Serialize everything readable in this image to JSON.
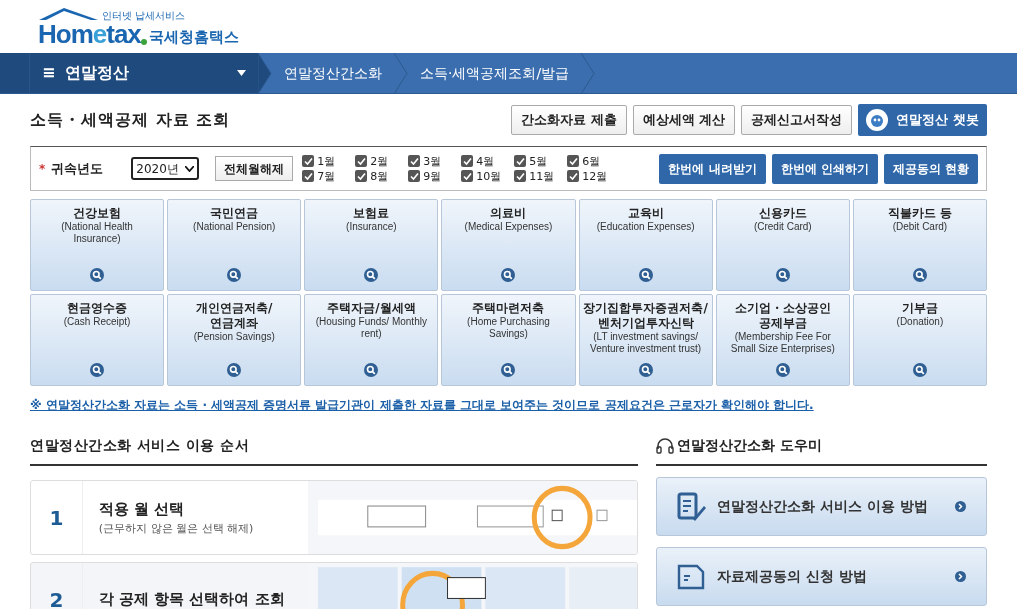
{
  "logo": {
    "tagline": "인터넷 납세서비스",
    "wordmark_left": "Hom",
    "wordmark_e": "e",
    "wordmark_right": "tax",
    "korean": "국세청홈택스"
  },
  "nav": {
    "menu_icon": "≡",
    "menu": "연말정산",
    "breadcrumbs": [
      "연말정산간소화",
      "소득·세액공제조회/발급"
    ]
  },
  "page_title": "소득・세액공제 자료 조회",
  "top_buttons": [
    {
      "label": "간소화자료 제출",
      "kind": "plain"
    },
    {
      "label": "예상세액 계산",
      "kind": "plain"
    },
    {
      "label": "공제신고서작성",
      "kind": "plain"
    },
    {
      "label": "연말정산 챗봇",
      "kind": "chatbot"
    }
  ],
  "filter": {
    "required_mark": "*",
    "label": "귀속년도",
    "year": "2020년",
    "clear_button": "전체월해제",
    "months": [
      {
        "label": "1월",
        "checked": true
      },
      {
        "label": "2월",
        "checked": true
      },
      {
        "label": "3월",
        "checked": true
      },
      {
        "label": "4월",
        "checked": true
      },
      {
        "label": "5월",
        "checked": true
      },
      {
        "label": "6월",
        "checked": true
      },
      {
        "label": "7월",
        "checked": true
      },
      {
        "label": "8월",
        "checked": true
      },
      {
        "label": "9월",
        "checked": true
      },
      {
        "label": "10월",
        "checked": true
      },
      {
        "label": "11월",
        "checked": true
      },
      {
        "label": "12월",
        "checked": true
      }
    ],
    "actions": [
      "한번에 내려받기",
      "한번에 인쇄하기",
      "제공동의 현황"
    ]
  },
  "categories": [
    {
      "title": "건강보험",
      "subtitle": "(National Health Insurance)"
    },
    {
      "title": "국민연금",
      "subtitle": "(National Pension)"
    },
    {
      "title": "보험료",
      "subtitle": "(Insurance)"
    },
    {
      "title": "의료비",
      "subtitle": "(Medical Expenses)"
    },
    {
      "title": "교육비",
      "subtitle": "(Education Expenses)"
    },
    {
      "title": "신용카드",
      "subtitle": "(Credit Card)"
    },
    {
      "title": "직불카드 등",
      "subtitle": "(Debit Card)"
    },
    {
      "title": "현금영수증",
      "subtitle": "(Cash Receipt)"
    },
    {
      "title": "개인연금저축/ 연금계좌",
      "subtitle": "(Pension Savings)"
    },
    {
      "title": "주택자금/월세액",
      "subtitle": "(Housing Funds/ Monthly rent)"
    },
    {
      "title": "주택마련저축",
      "subtitle": "(Home Purchasing Savings)"
    },
    {
      "title": "장기집합투자증권저축/ 벤처기업투자신탁",
      "subtitle": "(LT investment savings/ Venture investment trust)"
    },
    {
      "title": "소기업・소상공인 공제부금",
      "subtitle": "(Membership Fee For Small Size Enterprises)"
    },
    {
      "title": "기부금",
      "subtitle": "(Donation)"
    }
  ],
  "notice": "※ 연말정산간소화 자료는 소득 · 세액공제 증명서류 발급기관이 제출한 자료를 그대로 보여주는 것이므로 공제요건은 근로자가 확인해야 합니다.",
  "steps_section": {
    "title": "연말정산간소화 서비스 이용 순서",
    "steps": [
      {
        "number": "1",
        "title": "적용 월 선택",
        "note": "(근무하지 않은 월은 선택 해제)"
      },
      {
        "number": "2",
        "title": "각 공제 항목 선택하여 조회"
      }
    ]
  },
  "helper": {
    "title": "연말정산간소화 도우미",
    "links": [
      {
        "label": "연말정산간소화 서비스 이용 방법",
        "kind": "guide"
      },
      {
        "label": "자료제공동의 신청 방법",
        "kind": "document"
      }
    ]
  }
}
